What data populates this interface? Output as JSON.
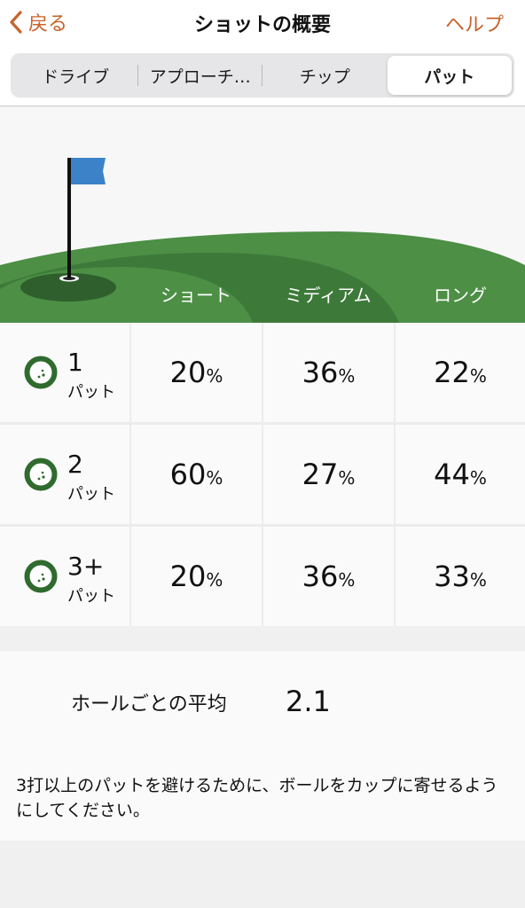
{
  "header": {
    "back_label": "戻る",
    "title": "ショットの概要",
    "help_label": "ヘルプ"
  },
  "tabs": [
    {
      "label": "ドライブ",
      "active": false
    },
    {
      "label": "アプローチ…",
      "active": false
    },
    {
      "label": "チップ",
      "active": false
    },
    {
      "label": "パット",
      "active": true
    }
  ],
  "illustration": {
    "zones": [
      "ショート",
      "ミディアム",
      "ロング"
    ],
    "flag_color": "#3b82c9",
    "green_colors": [
      "#4c8f45",
      "#3d7a3a",
      "#2f5f2d"
    ]
  },
  "table": {
    "rows": [
      {
        "putts": "1",
        "unit": "パット",
        "values": [
          "20",
          "36",
          "22"
        ]
      },
      {
        "putts": "2",
        "unit": "パット",
        "values": [
          "60",
          "27",
          "44"
        ]
      },
      {
        "putts": "3+",
        "unit": "パット",
        "values": [
          "20",
          "36",
          "33"
        ]
      }
    ],
    "percent_sign": "%"
  },
  "summary": {
    "avg_label": "ホールごとの平均",
    "avg_value": "2.1",
    "tip": "3打以上のパットを避けるために、ボールをカップに寄せるようにしてください。"
  },
  "colors": {
    "accent": "#c8632d",
    "ball_icon": "#2f6b2e"
  }
}
